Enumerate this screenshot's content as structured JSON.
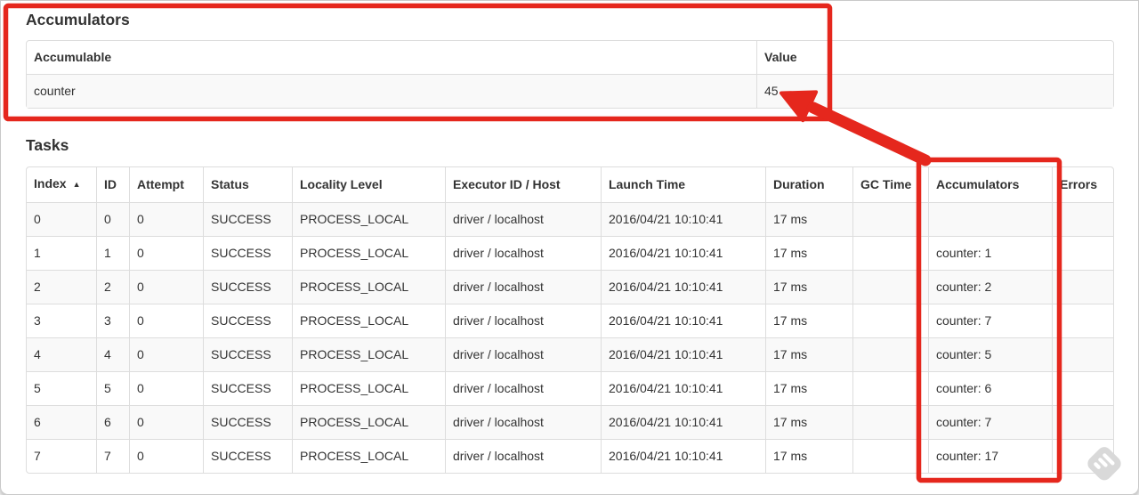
{
  "accumulators_section": {
    "heading": "Accumulators",
    "table": {
      "headers": {
        "accumulable": "Accumulable",
        "value": "Value"
      },
      "rows": [
        {
          "accumulable": "counter",
          "value": "45"
        }
      ]
    }
  },
  "tasks_section": {
    "heading": "Tasks",
    "table": {
      "headers": {
        "index": "Index",
        "id": "ID",
        "attempt": "Attempt",
        "status": "Status",
        "locality": "Locality Level",
        "executor": "Executor ID / Host",
        "launch": "Launch Time",
        "duration": "Duration",
        "gc": "GC Time",
        "accumulators": "Accumulators",
        "errors": "Errors"
      },
      "sort_icon": "▲",
      "rows": [
        {
          "index": "0",
          "id": "0",
          "attempt": "0",
          "status": "SUCCESS",
          "locality": "PROCESS_LOCAL",
          "executor": "driver / localhost",
          "launch": "2016/04/21 10:10:41",
          "duration": "17 ms",
          "gc": "",
          "accumulators": "",
          "errors": ""
        },
        {
          "index": "1",
          "id": "1",
          "attempt": "0",
          "status": "SUCCESS",
          "locality": "PROCESS_LOCAL",
          "executor": "driver / localhost",
          "launch": "2016/04/21 10:10:41",
          "duration": "17 ms",
          "gc": "",
          "accumulators": "counter: 1",
          "errors": ""
        },
        {
          "index": "2",
          "id": "2",
          "attempt": "0",
          "status": "SUCCESS",
          "locality": "PROCESS_LOCAL",
          "executor": "driver / localhost",
          "launch": "2016/04/21 10:10:41",
          "duration": "17 ms",
          "gc": "",
          "accumulators": "counter: 2",
          "errors": ""
        },
        {
          "index": "3",
          "id": "3",
          "attempt": "0",
          "status": "SUCCESS",
          "locality": "PROCESS_LOCAL",
          "executor": "driver / localhost",
          "launch": "2016/04/21 10:10:41",
          "duration": "17 ms",
          "gc": "",
          "accumulators": "counter: 7",
          "errors": ""
        },
        {
          "index": "4",
          "id": "4",
          "attempt": "0",
          "status": "SUCCESS",
          "locality": "PROCESS_LOCAL",
          "executor": "driver / localhost",
          "launch": "2016/04/21 10:10:41",
          "duration": "17 ms",
          "gc": "",
          "accumulators": "counter: 5",
          "errors": ""
        },
        {
          "index": "5",
          "id": "5",
          "attempt": "0",
          "status": "SUCCESS",
          "locality": "PROCESS_LOCAL",
          "executor": "driver / localhost",
          "launch": "2016/04/21 10:10:41",
          "duration": "17 ms",
          "gc": "",
          "accumulators": "counter: 6",
          "errors": ""
        },
        {
          "index": "6",
          "id": "6",
          "attempt": "0",
          "status": "SUCCESS",
          "locality": "PROCESS_LOCAL",
          "executor": "driver / localhost",
          "launch": "2016/04/21 10:10:41",
          "duration": "17 ms",
          "gc": "",
          "accumulators": "counter: 7",
          "errors": ""
        },
        {
          "index": "7",
          "id": "7",
          "attempt": "0",
          "status": "SUCCESS",
          "locality": "PROCESS_LOCAL",
          "executor": "driver / localhost",
          "launch": "2016/04/21 10:10:41",
          "duration": "17 ms",
          "gc": "",
          "accumulators": "counter: 17",
          "errors": ""
        }
      ]
    }
  },
  "annotations": {
    "accent_color": "#e5271d"
  },
  "watermark": {
    "fill_color": "#d9d9d9"
  }
}
